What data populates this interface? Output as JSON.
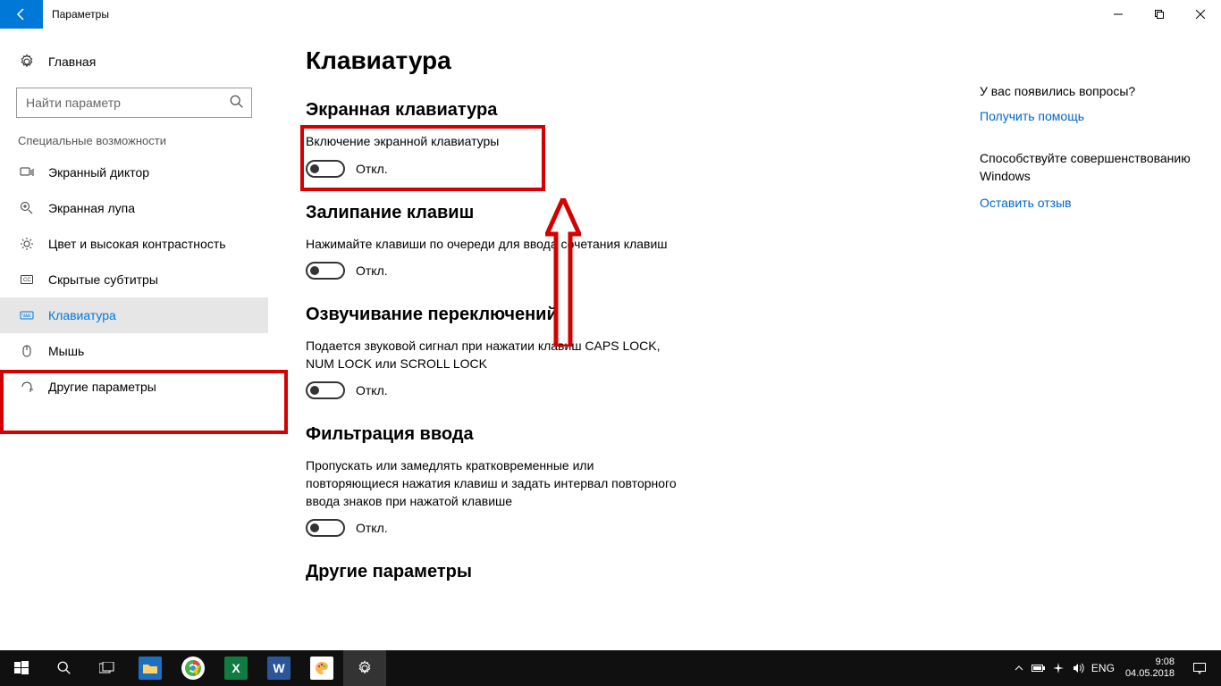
{
  "title": "Параметры",
  "sidebar": {
    "home": "Главная",
    "search_placeholder": "Найти параметр",
    "group": "Специальные возможности",
    "items": [
      {
        "label": "Экранный диктор"
      },
      {
        "label": "Экранная лупа"
      },
      {
        "label": "Цвет и высокая контрастность"
      },
      {
        "label": "Скрытые субтитры"
      },
      {
        "label": "Клавиатура"
      },
      {
        "label": "Мышь"
      },
      {
        "label": "Другие параметры"
      }
    ]
  },
  "page": {
    "heading": "Клавиатура",
    "sections": [
      {
        "title": "Экранная клавиатура",
        "label": "Включение экранной клавиатуры",
        "state": "Откл."
      },
      {
        "title": "Залипание клавиш",
        "label": "Нажимайте клавиши по очереди для ввода сочетания клавиш",
        "state": "Откл."
      },
      {
        "title": "Озвучивание переключений",
        "label": "Подается звуковой сигнал при нажатии клавиш CAPS LOCK, NUM LOCK или SCROLL LOCK",
        "state": "Откл."
      },
      {
        "title": "Фильтрация ввода",
        "label": "Пропускать или замедлять кратковременные или повторяющиеся нажатия клавиш и задать интервал повторного ввода знаков при нажатой клавише",
        "state": "Откл."
      },
      {
        "title": "Другие параметры",
        "label": "",
        "state": ""
      }
    ]
  },
  "right": {
    "q_heading": "У вас появились вопросы?",
    "help_link": "Получить помощь",
    "improve_text": "Способствуйте совершенствованию Windows",
    "feedback_link": "Оставить отзыв"
  },
  "taskbar": {
    "lang": "ENG",
    "time": "9:08",
    "date": "04.05.2018"
  }
}
